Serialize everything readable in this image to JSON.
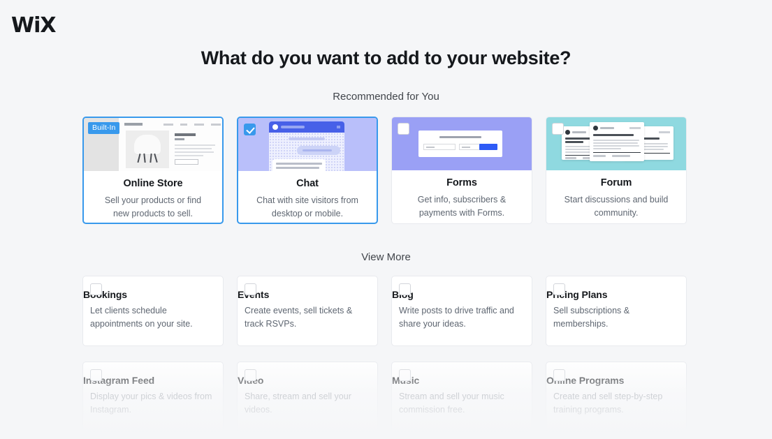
{
  "brand": {
    "logo_text": "WiX"
  },
  "header": {
    "title": "What do you want to add to your website?"
  },
  "sections": {
    "recommended_label": "Recommended for You",
    "view_more_label": "View More"
  },
  "badges": {
    "built_in": "Built-In"
  },
  "colors": {
    "page_background": "#f5f6f8",
    "accent_blue": "#3899ec",
    "title_text": "#15181c",
    "body_text": "#5e6671",
    "thumb_store": "#e3e3e3",
    "thumb_chat": "#b9bffa",
    "thumb_forms": "#9aa0f5",
    "thumb_forum": "#8fd9e0",
    "chat_header_blue": "#4760e8",
    "forms_submit_blue": "#2e5bf6"
  },
  "recommended": [
    {
      "name": "Online Store",
      "description": "Sell your products or find new products to sell.",
      "checked": false,
      "badge": "Built-In",
      "highlighted": true,
      "thumbnail": "online-store-thumbnail"
    },
    {
      "name": "Chat",
      "description": "Chat with site visitors from desktop or mobile.",
      "checked": true,
      "badge": null,
      "highlighted": true,
      "thumbnail": "chat-thumbnail"
    },
    {
      "name": "Forms",
      "description": "Get info, subscribers & payments with Forms.",
      "checked": false,
      "badge": null,
      "highlighted": false,
      "thumbnail": "forms-thumbnail"
    },
    {
      "name": "Forum",
      "description": "Start discussions and build community.",
      "checked": false,
      "badge": null,
      "highlighted": false,
      "thumbnail": "forum-thumbnail"
    }
  ],
  "view_more_row1": [
    {
      "name": "Bookings",
      "description": "Let clients schedule appointments on your site.",
      "checked": false
    },
    {
      "name": "Events",
      "description": "Create events, sell tickets & track RSVPs.",
      "checked": false
    },
    {
      "name": "Blog",
      "description": "Write posts to drive traffic and share your ideas.",
      "checked": false
    },
    {
      "name": "Pricing Plans",
      "description": "Sell subscriptions & memberships.",
      "checked": false
    }
  ],
  "view_more_row2": [
    {
      "name": "Instagram Feed",
      "description": "Display your pics & videos from Instagram.",
      "checked": false
    },
    {
      "name": "Video",
      "description": "Share, stream and sell your videos.",
      "checked": false
    },
    {
      "name": "Music",
      "description": "Stream and sell your music commission free.",
      "checked": false
    },
    {
      "name": "Online Programs",
      "description": "Create and sell step-by-step training programs.",
      "checked": false
    }
  ]
}
